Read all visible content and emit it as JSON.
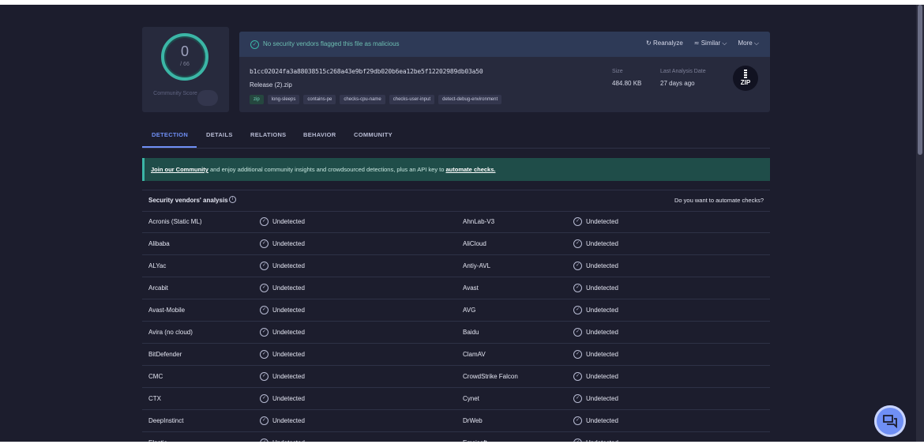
{
  "score": {
    "value": "0",
    "total": "/ 66",
    "community_label": "Community Score"
  },
  "banner": {
    "message": "No security vendors flagged this file as malicious",
    "reanalyze": "Reanalyze",
    "similar": "Similar",
    "more": "More"
  },
  "file": {
    "hash": "b1cc02024fa3a88038515c268a43e9bf29db020b6ea12be5f12202989db03a50",
    "name": "Release (2).zip",
    "tags": [
      "zip",
      "long-sleeps",
      "contains-pe",
      "checks-cpu-name",
      "checks-user-input",
      "detect-debug-environment"
    ],
    "size_label": "Size",
    "size_value": "484.80 KB",
    "date_label": "Last Analysis Date",
    "date_value": "27 days ago",
    "type_icon": "ZIP"
  },
  "tabs": [
    "DETECTION",
    "DETAILS",
    "RELATIONS",
    "BEHAVIOR",
    "COMMUNITY"
  ],
  "promo": {
    "link1": "Join our Community",
    "middle": " and enjoy additional community insights and crowdsourced detections, plus an API key to ",
    "link2": "automate checks."
  },
  "analysis": {
    "title": "Security vendors' analysis",
    "automate_question": "Do you want to automate checks?",
    "rows": [
      {
        "v1": "Acronis (Static ML)",
        "r1": "Undetected",
        "v2": "AhnLab-V3",
        "r2": "Undetected"
      },
      {
        "v1": "Alibaba",
        "r1": "Undetected",
        "v2": "AliCloud",
        "r2": "Undetected"
      },
      {
        "v1": "ALYac",
        "r1": "Undetected",
        "v2": "Antiy-AVL",
        "r2": "Undetected"
      },
      {
        "v1": "Arcabit",
        "r1": "Undetected",
        "v2": "Avast",
        "r2": "Undetected"
      },
      {
        "v1": "Avast-Mobile",
        "r1": "Undetected",
        "v2": "AVG",
        "r2": "Undetected"
      },
      {
        "v1": "Avira (no cloud)",
        "r1": "Undetected",
        "v2": "Baidu",
        "r2": "Undetected"
      },
      {
        "v1": "BitDefender",
        "r1": "Undetected",
        "v2": "ClamAV",
        "r2": "Undetected"
      },
      {
        "v1": "CMC",
        "r1": "Undetected",
        "v2": "CrowdStrike Falcon",
        "r2": "Undetected"
      },
      {
        "v1": "CTX",
        "r1": "Undetected",
        "v2": "Cynet",
        "r2": "Undetected"
      },
      {
        "v1": "DeepInstinct",
        "r1": "Undetected",
        "v2": "DrWeb",
        "r2": "Undetected"
      },
      {
        "v1": "Elastic",
        "r1": "Undetected",
        "v2": "Emsisoft",
        "r2": "Undetected"
      }
    ]
  },
  "colors": {
    "accent": "#6f8ff5",
    "teal": "#3bb6a6",
    "background": "#1c1d2d"
  }
}
